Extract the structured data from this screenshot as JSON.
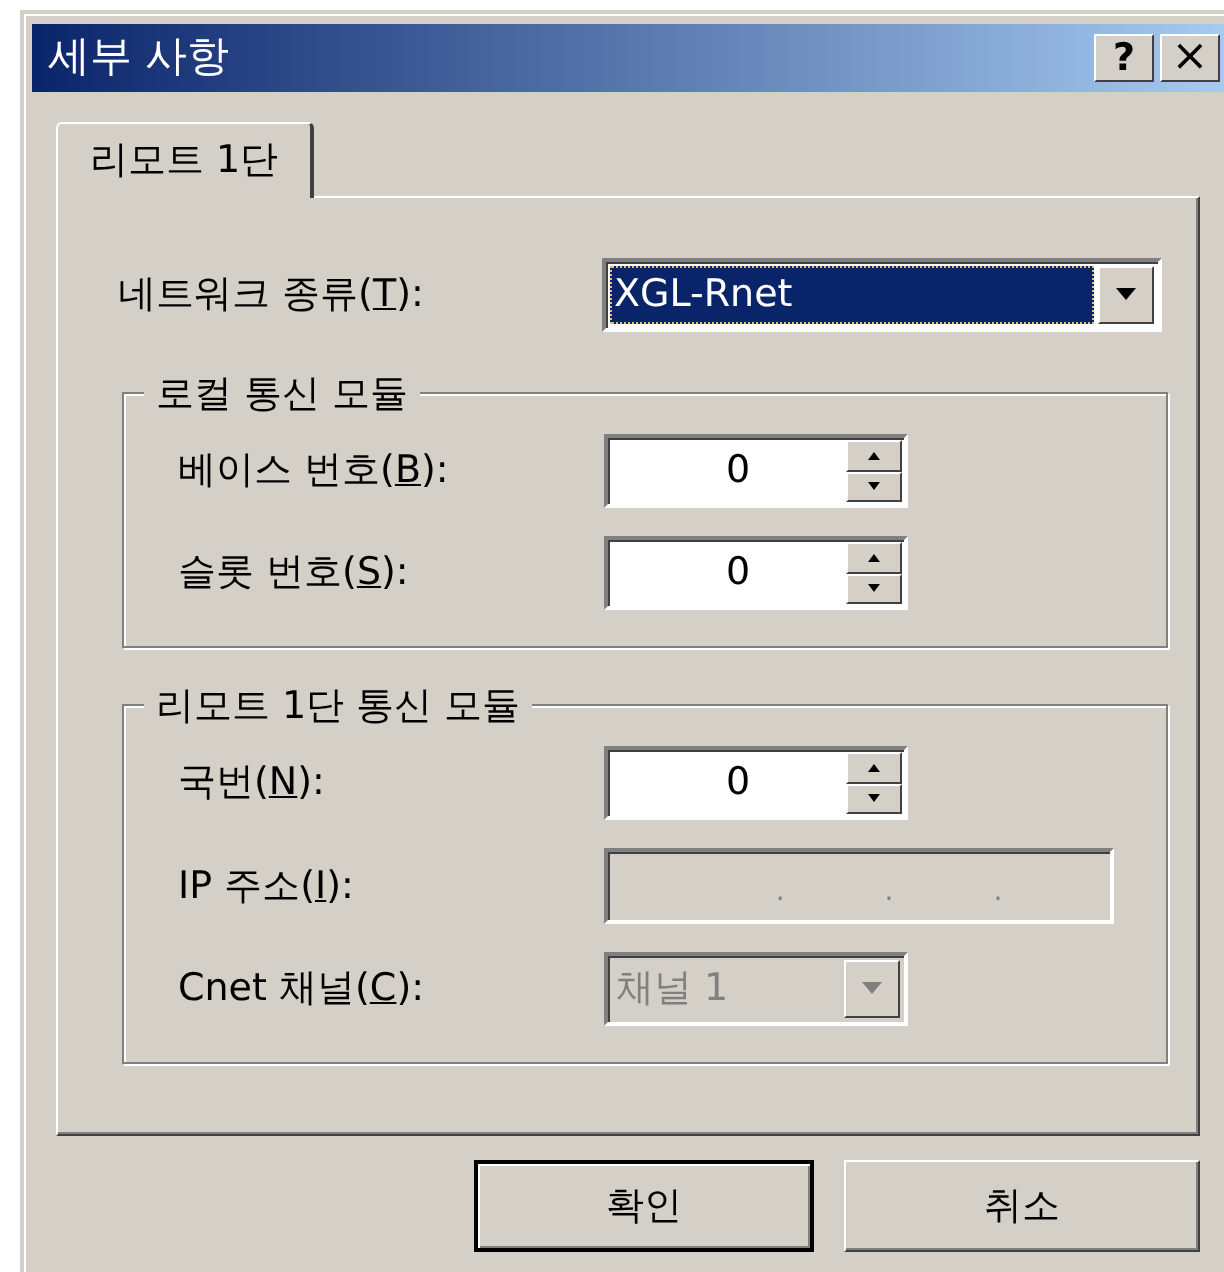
{
  "window": {
    "title": "세부 사항",
    "help_button": "?",
    "close_button": "×"
  },
  "tabs": [
    {
      "label": "리모트 1단",
      "selected": true
    }
  ],
  "network_type": {
    "label": {
      "before": "네트워크 종류(",
      "key": "T",
      "after": "):"
    },
    "value": "XGL-Rnet",
    "focused": true
  },
  "groups": [
    {
      "title": "로컬 통신 모듈",
      "fields": [
        {
          "kind": "spin",
          "label": {
            "before": "베이스 번호(",
            "key": "B",
            "after": "):"
          },
          "value": "0",
          "disabled": false
        },
        {
          "kind": "spin",
          "label": {
            "before": "슬롯 번호(",
            "key": "S",
            "after": "):"
          },
          "value": "0",
          "disabled": false
        }
      ]
    },
    {
      "title": "리모트 1단 통신 모듈",
      "fields": [
        {
          "kind": "spin",
          "label": {
            "before": "국번(",
            "key": "N",
            "after": "):"
          },
          "value": "0",
          "disabled": false
        },
        {
          "kind": "ip",
          "label": {
            "before": "IP 주소(",
            "key": "I",
            "after": "):"
          },
          "dots": [
            ".",
            ".",
            "."
          ],
          "disabled": true
        },
        {
          "kind": "combo",
          "label": {
            "before": "Cnet 채널(",
            "key": "C",
            "after": "):"
          },
          "value": "채널 1",
          "disabled": true
        }
      ]
    }
  ],
  "buttons": [
    {
      "label": "확인",
      "default": true
    },
    {
      "label": "취소",
      "default": false
    }
  ]
}
